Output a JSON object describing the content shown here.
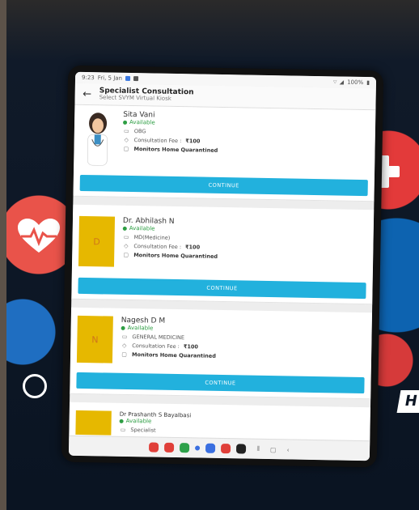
{
  "status": {
    "time": "9:23",
    "date": "Fri, 5 Jan",
    "battery": "100%"
  },
  "header": {
    "title": "Specialist Consultation",
    "subtitle": "Select SVYM Virtual Kiosk"
  },
  "doctors": [
    {
      "name": "Sita Vani",
      "availability": "Available",
      "specialty": "OBG",
      "fee_label": "Consultation Fee :",
      "fee_value": "₹100",
      "monitors": "Monitors Home Quarantined",
      "continue": "CONTINUE",
      "avatar": "doctor-illustration"
    },
    {
      "name": "Dr. Abhilash N",
      "availability": "Available",
      "specialty": "MD(Medicine)",
      "fee_label": "Consultation Fee :",
      "fee_value": "₹100",
      "monitors": "Monitors Home Quarantined",
      "continue": "CONTINUE",
      "avatar_letter": "D"
    },
    {
      "name": "Nagesh D M",
      "availability": "Available",
      "specialty": "GENERAL MEDICINE",
      "fee_label": "Consultation Fee :",
      "fee_value": "₹100",
      "monitors": "Monitors Home Quarantined",
      "continue": "CONTINUE",
      "avatar_letter": "N"
    },
    {
      "name": "Dr Prashanth S Bayalbasi",
      "availability": "Available",
      "specialty": "Specialist"
    }
  ],
  "colors": {
    "accent": "#22b1dd",
    "available": "#2e9e44",
    "avatar_bg": "#e6b800"
  }
}
